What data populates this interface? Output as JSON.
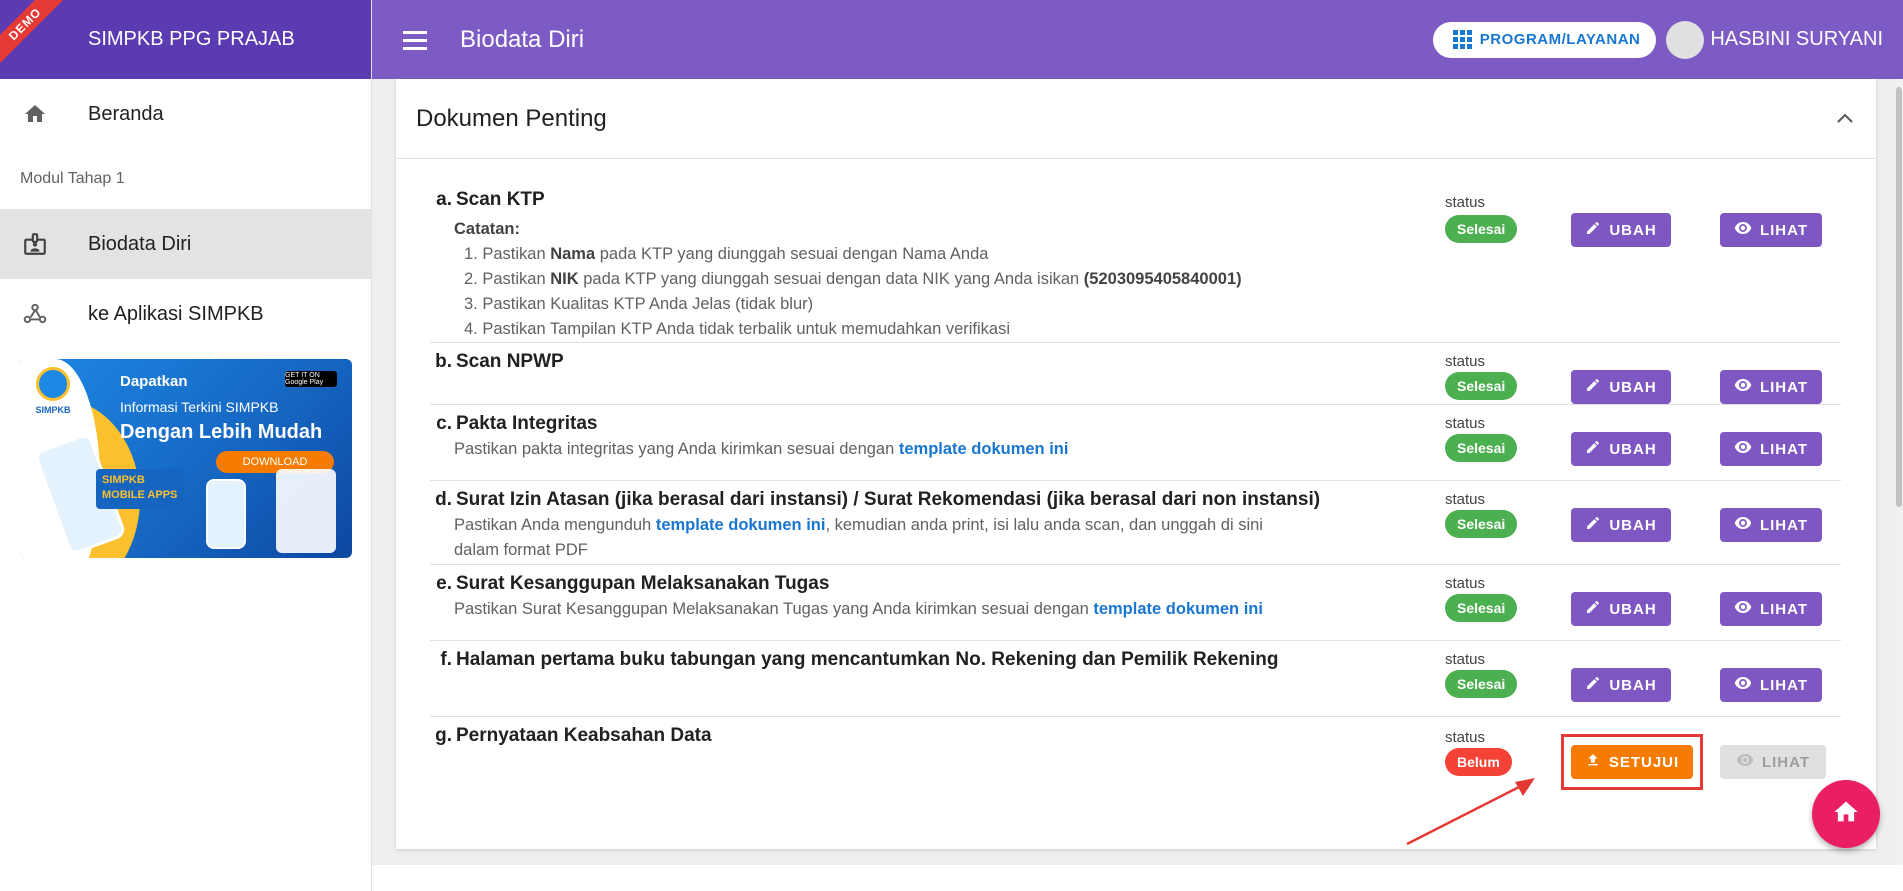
{
  "brand": {
    "demo_ribbon": "DEMO",
    "title": "SIMPKB PPG PRAJAB"
  },
  "header": {
    "page_title": "Biodata Diri",
    "program_button": "PROGRAM/LAYANAN",
    "user_name": "HASBINI SURYANI"
  },
  "sidebar": {
    "items": [
      {
        "label": "Beranda",
        "icon": "home-icon"
      },
      {
        "label": "Modul Tahap 1",
        "type": "section"
      },
      {
        "label": "Biodata Diri",
        "icon": "badge-icon",
        "active": true
      },
      {
        "label": "ke Aplikasi SIMPKB",
        "icon": "webhook-icon"
      }
    ],
    "promo": {
      "logo": "SIMPKB",
      "google_play": "GET IT ON Google Play",
      "line1": "Dapatkan",
      "line2": "Informasi Terkini SIMPKB",
      "line3": "Dengan Lebih Mudah",
      "download": "DOWNLOAD",
      "mobile_apps": "SIMPKB MOBILE APPS"
    }
  },
  "card": {
    "title": "Dokumen Penting",
    "status_label": "status",
    "ubah_label": "UBAH",
    "lihat_label": "LIHAT",
    "setujui_label": "SETUJUI",
    "documents": [
      {
        "letter": "a.",
        "title": "Scan KTP",
        "status": "Selesai",
        "note_title": "Catatan:",
        "notes": [
          {
            "pre": "1. Pastikan ",
            "bold": "Nama",
            "post": " pada KTP yang diunggah sesuai dengan Nama Anda"
          },
          {
            "pre": "2. Pastikan ",
            "bold": "NIK",
            "post": " pada KTP yang diunggah sesuai dengan data NIK yang Anda isikan ",
            "bold2": "(5203095405840001)"
          },
          {
            "pre": "3. Pastikan Kualitas KTP Anda Jelas (tidak blur)"
          },
          {
            "pre": "4. Pastikan Tampilan KTP Anda tidak terbalik untuk memudahkan verifikasi"
          }
        ]
      },
      {
        "letter": "b.",
        "title": "Scan NPWP",
        "status": "Selesai"
      },
      {
        "letter": "c.",
        "title": "Pakta Integritas",
        "status": "Selesai",
        "desc_pre": "Pastikan pakta integritas yang Anda kirimkan sesuai dengan ",
        "desc_link": "template dokumen ini"
      },
      {
        "letter": "d.",
        "title": "Surat Izin Atasan (jika berasal dari instansi) / Surat Rekomendasi (jika berasal dari non instansi)",
        "status": "Selesai",
        "desc_pre": "Pastikan Anda mengunduh ",
        "desc_link": "template dokumen ini",
        "desc_post": ", kemudian anda print, isi lalu anda scan, dan unggah di sini",
        "desc_line2": "dalam format PDF"
      },
      {
        "letter": "e.",
        "title": "Surat Kesanggupan Melaksanakan Tugas",
        "status": "Selesai",
        "desc_pre": "Pastikan Surat Kesanggupan Melaksanakan Tugas yang Anda kirimkan sesuai dengan ",
        "desc_link": "template dokumen ini"
      },
      {
        "letter": "f.",
        "title": "Halaman pertama buku tabungan yang mencantumkan No. Rekening dan Pemilik Rekening",
        "status": "Selesai"
      },
      {
        "letter": "g.",
        "title": "Pernyataan Keabsahan Data",
        "status": "Belum"
      }
    ]
  },
  "colors": {
    "topbar": "#7c5cc4",
    "brand": "#5a3bb1",
    "button": "#7e57c2",
    "success": "#4caf50",
    "danger": "#f44336",
    "warning": "#f57c00",
    "fab": "#e91e63",
    "link": "#1976d2"
  }
}
